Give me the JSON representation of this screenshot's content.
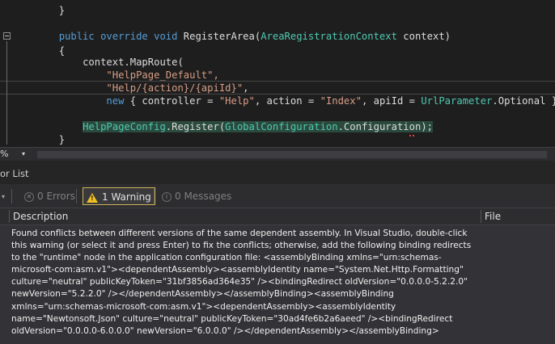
{
  "editor": {
    "lines": [
      {
        "indent": "        ",
        "text": "}"
      },
      {
        "indent": "",
        "text": ""
      },
      {
        "indent": "        ",
        "text": "public override void RegisterArea(AreaRegistrationContext context)"
      },
      {
        "indent": "        ",
        "text": "{"
      },
      {
        "indent": "            ",
        "text": "context.MapRoute("
      },
      {
        "indent": "                ",
        "text": "\"HelpPage_Default\","
      },
      {
        "indent": "                ",
        "text": "\"Help/{action}/{apiId}\","
      },
      {
        "indent": "                ",
        "text": "new { controller = \"Help\", action = \"Index\", apiId = UrlParameter.Optional });"
      },
      {
        "indent": "",
        "text": ""
      },
      {
        "indent": "            ",
        "text": "HelpPageConfig.Register(GlobalConfiguration.Configuration);"
      },
      {
        "indent": "        ",
        "text": "}"
      }
    ]
  },
  "status": {
    "zoom": "%",
    "zoom_dropdown": "▾"
  },
  "error_list": {
    "title": "or List",
    "filters": {
      "errors": "0 Errors",
      "warnings": "1 Warning",
      "messages": "0 Messages"
    },
    "columns": {
      "description": "Description",
      "file": "File"
    },
    "rows": [
      {
        "description": "Found conflicts between different versions of the same dependent assembly. In Visual Studio, double-click this warning (or select it and press Enter) to fix the conflicts; otherwise, add the following binding redirects to the \"runtime\" node in the application configuration file: <assemblyBinding xmlns=\"urn:schemas-microsoft-com:asm.v1\"><dependentAssembly><assemblyIdentity name=\"System.Net.Http.Formatting\" culture=\"neutral\" publicKeyToken=\"31bf3856ad364e35\" /><bindingRedirect oldVersion=\"0.0.0.0-5.2.2.0\" newVersion=\"5.2.2.0\" /></dependentAssembly></assemblyBinding><assemblyBinding xmlns=\"urn:schemas-microsoft-com:asm.v1\"><dependentAssembly><assemblyIdentity name=\"Newtonsoft.Json\" culture=\"neutral\" publicKeyToken=\"30ad4fe6b2a6aeed\" /><bindingRedirect oldVersion=\"0.0.0.0-6.0.0.0\" newVersion=\"6.0.0.0\" /></dependentAssembly></assemblyBinding>",
        "file": ""
      }
    ]
  },
  "colors": {
    "keyword": "#569cd6",
    "type": "#4ec9b0",
    "string": "#d69d85",
    "warning": "#f0c020"
  }
}
